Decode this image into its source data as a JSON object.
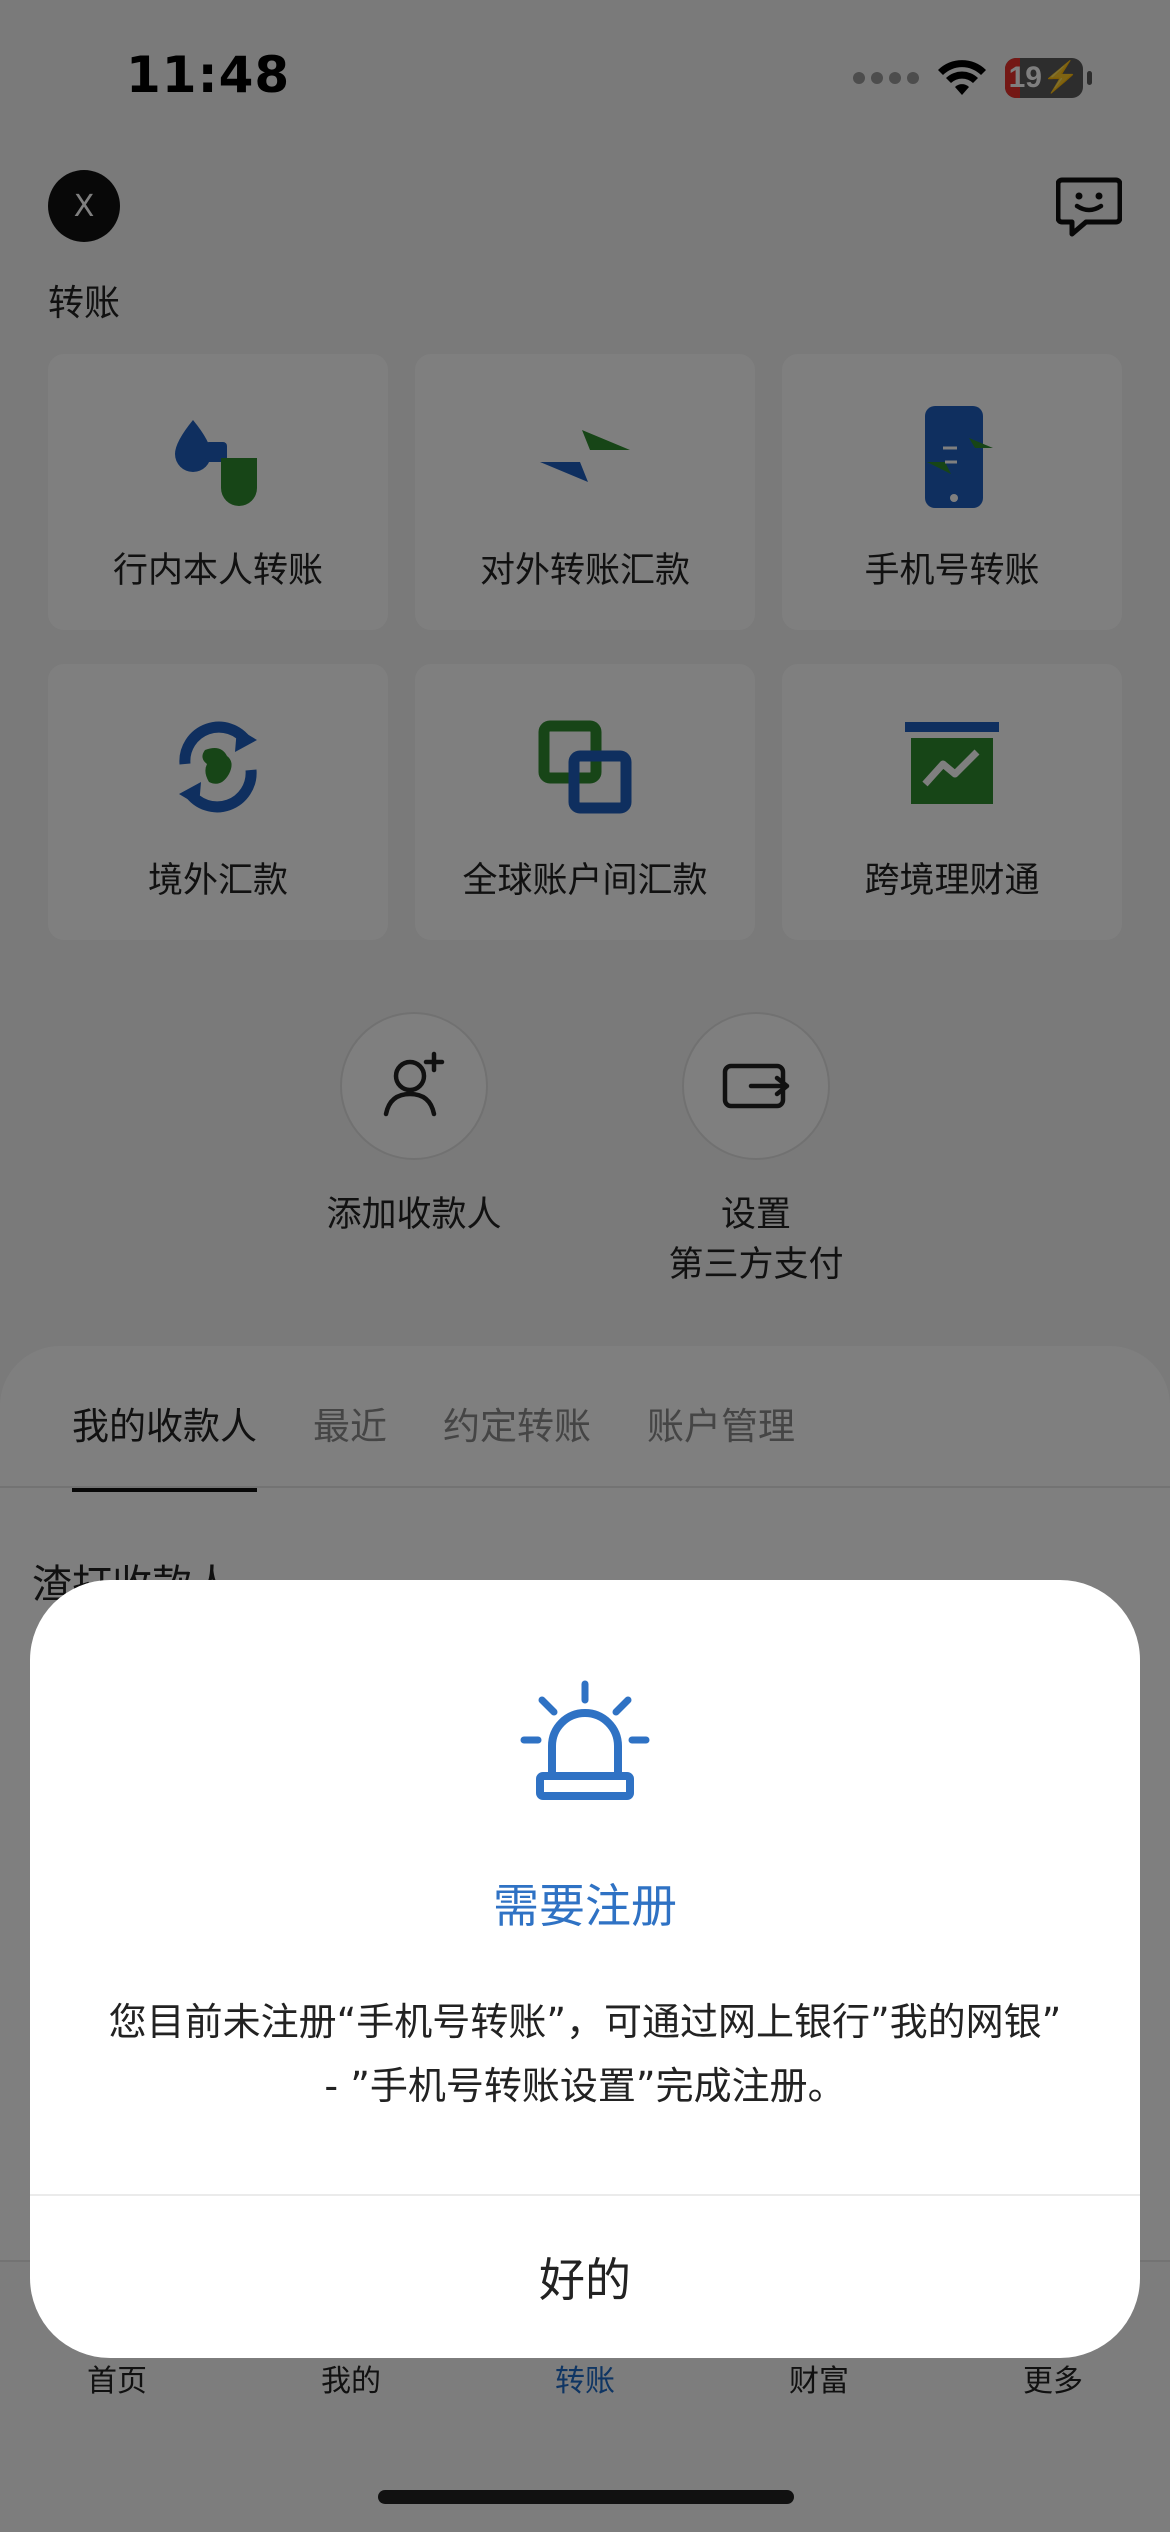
{
  "status_bar": {
    "time": "11:48",
    "battery_level": "19",
    "icons": [
      "cellular-signal-icon",
      "wifi-icon",
      "battery-charging-icon"
    ]
  },
  "header": {
    "close_label": "X",
    "title": "转账",
    "chat_icon": "chat-bubble-icon"
  },
  "tiles": [
    {
      "label": "行内本人转账",
      "icon": "own-account-transfer-icon"
    },
    {
      "label": "对外转账汇款",
      "icon": "exchange-arrows-icon"
    },
    {
      "label": "手机号转账",
      "icon": "mobile-transfer-icon"
    },
    {
      "label": "境外汇款",
      "icon": "overseas-remittance-icon"
    },
    {
      "label": "全球账户间汇款",
      "icon": "global-accounts-icon"
    },
    {
      "label": "跨境理财通",
      "icon": "cross-border-wealth-icon"
    }
  ],
  "actions": {
    "add_payee": "添加收款人",
    "third_party_line1": "设置",
    "third_party_line2": "第三方支付"
  },
  "tabs": [
    "我的收款人",
    "最近",
    "约定转账",
    "账户管理"
  ],
  "payees": {
    "heading": "渣打收款人"
  },
  "bottom_nav": [
    "首页",
    "我的",
    "转账",
    "财富",
    "更多"
  ],
  "dialog": {
    "icon": "alarm-siren-icon",
    "title": "需要注册",
    "message": "您目前未注册“手机号转账”，可通过网上银行”我的网银” - ”手机号转账设置”完成注册。",
    "ok_label": "好的"
  },
  "colors": {
    "brand_blue": "#1e6bc6",
    "brand_green": "#2e8b2e",
    "dialog_title": "#2f72c4",
    "battery_low": "#e8302a"
  }
}
